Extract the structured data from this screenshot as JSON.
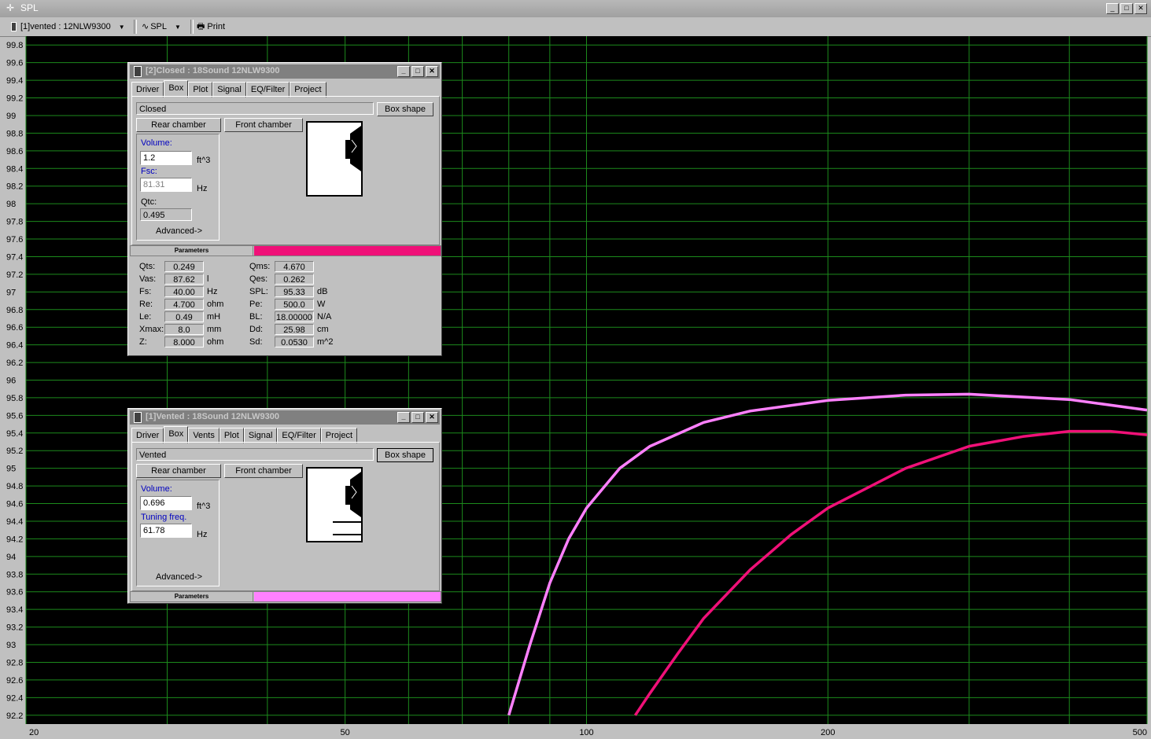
{
  "window": {
    "title": "SPL"
  },
  "toolbar": {
    "project_select": "[1]vented : 12NLW9300",
    "view_select": "SPL",
    "print_label": "Print"
  },
  "chart_data": {
    "type": "line",
    "x_scale": "log",
    "xlim": [
      20,
      500
    ],
    "ylim": [
      92.1,
      99.9
    ],
    "grid": true,
    "x_ticks": [
      "20",
      "50",
      "100",
      "200",
      "500"
    ],
    "y_ticks": [
      "99.8",
      "99.6",
      "99.4",
      "99.2",
      "99",
      "98.8",
      "98.6",
      "98.4",
      "98.2",
      "98",
      "97.8",
      "97.6",
      "97.4",
      "97.2",
      "97",
      "96.8",
      "96.6",
      "96.4",
      "96.2",
      "96",
      "95.8",
      "95.6",
      "95.4",
      "95.2",
      "95",
      "94.8",
      "94.6",
      "94.4",
      "94.2",
      "94",
      "93.8",
      "93.6",
      "93.4",
      "93.2",
      "93",
      "92.8",
      "92.6",
      "92.4",
      "92.2"
    ],
    "series": [
      {
        "color": "#ff80ff",
        "x": [
          80,
          85,
          90,
          95,
          100,
          110,
          120,
          140,
          160,
          200,
          250,
          300,
          400,
          500
        ],
        "y": [
          92.2,
          93.0,
          93.7,
          94.2,
          94.55,
          95.0,
          95.25,
          95.52,
          95.65,
          95.77,
          95.83,
          95.84,
          95.78,
          95.66
        ]
      },
      {
        "color": "#f01078",
        "x": [
          115,
          120,
          130,
          140,
          160,
          180,
          200,
          250,
          300,
          350,
          400,
          450,
          500
        ],
        "y": [
          92.2,
          92.45,
          92.9,
          93.3,
          93.85,
          94.25,
          94.55,
          95.0,
          95.25,
          95.36,
          95.42,
          95.42,
          95.38
        ]
      }
    ]
  },
  "dialog_closed": {
    "title": "[2]Closed : 18Sound 12NLW9300",
    "tabs": [
      "Driver",
      "Box",
      "Plot",
      "Signal",
      "EQ/Filter",
      "Project"
    ],
    "box_type": "Closed",
    "box_shape_label": "Box shape",
    "rear_chamber_label": "Rear chamber",
    "front_chamber_label": "Front chamber",
    "volume_label": "Volume:",
    "volume_value": "1.2",
    "volume_unit": "ft^3",
    "fsc_label": "Fsc:",
    "fsc_value": "81.31",
    "fsc_unit": "Hz",
    "qtc_label": "Qtc:",
    "qtc_value": "0.495",
    "advanced_label": "Advanced->",
    "params_label": "Parameters",
    "params_color": "#f01078",
    "params_left": [
      {
        "name": "Qts:",
        "value": "0.249",
        "unit": ""
      },
      {
        "name": "Vas:",
        "value": "87.62",
        "unit": "l"
      },
      {
        "name": "Fs:",
        "value": "40.00",
        "unit": "Hz"
      },
      {
        "name": "Re:",
        "value": "4.700",
        "unit": "ohm"
      },
      {
        "name": "Le:",
        "value": "0.49",
        "unit": "mH"
      },
      {
        "name": "Xmax:",
        "value": "8.0",
        "unit": "mm"
      },
      {
        "name": "Z:",
        "value": "8.000",
        "unit": "ohm"
      }
    ],
    "params_right": [
      {
        "name": "Qms:",
        "value": "4.670",
        "unit": ""
      },
      {
        "name": "Qes:",
        "value": "0.262",
        "unit": ""
      },
      {
        "name": "SPL:",
        "value": "95.33",
        "unit": "dB"
      },
      {
        "name": "Pe:",
        "value": "500.0",
        "unit": "W"
      },
      {
        "name": "BL:",
        "value": "18.00000",
        "unit": "N/A"
      },
      {
        "name": "Dd:",
        "value": "25.98",
        "unit": "cm"
      },
      {
        "name": "Sd:",
        "value": "0.0530",
        "unit": "m^2"
      }
    ]
  },
  "dialog_vented": {
    "title": "[1]Vented : 18Sound 12NLW9300",
    "tabs": [
      "Driver",
      "Box",
      "Vents",
      "Plot",
      "Signal",
      "EQ/Filter",
      "Project"
    ],
    "box_type": "Vented",
    "box_shape_label": "Box shape",
    "rear_chamber_label": "Rear chamber",
    "front_chamber_label": "Front chamber",
    "volume_label": "Volume:",
    "volume_value": "0.696",
    "volume_unit": "ft^3",
    "tuning_label": "Tuning freq.",
    "tuning_value": "61.78",
    "tuning_unit": "Hz",
    "advanced_label": "Advanced->",
    "params_label": "Parameters",
    "params_color": "#ff80ff"
  }
}
